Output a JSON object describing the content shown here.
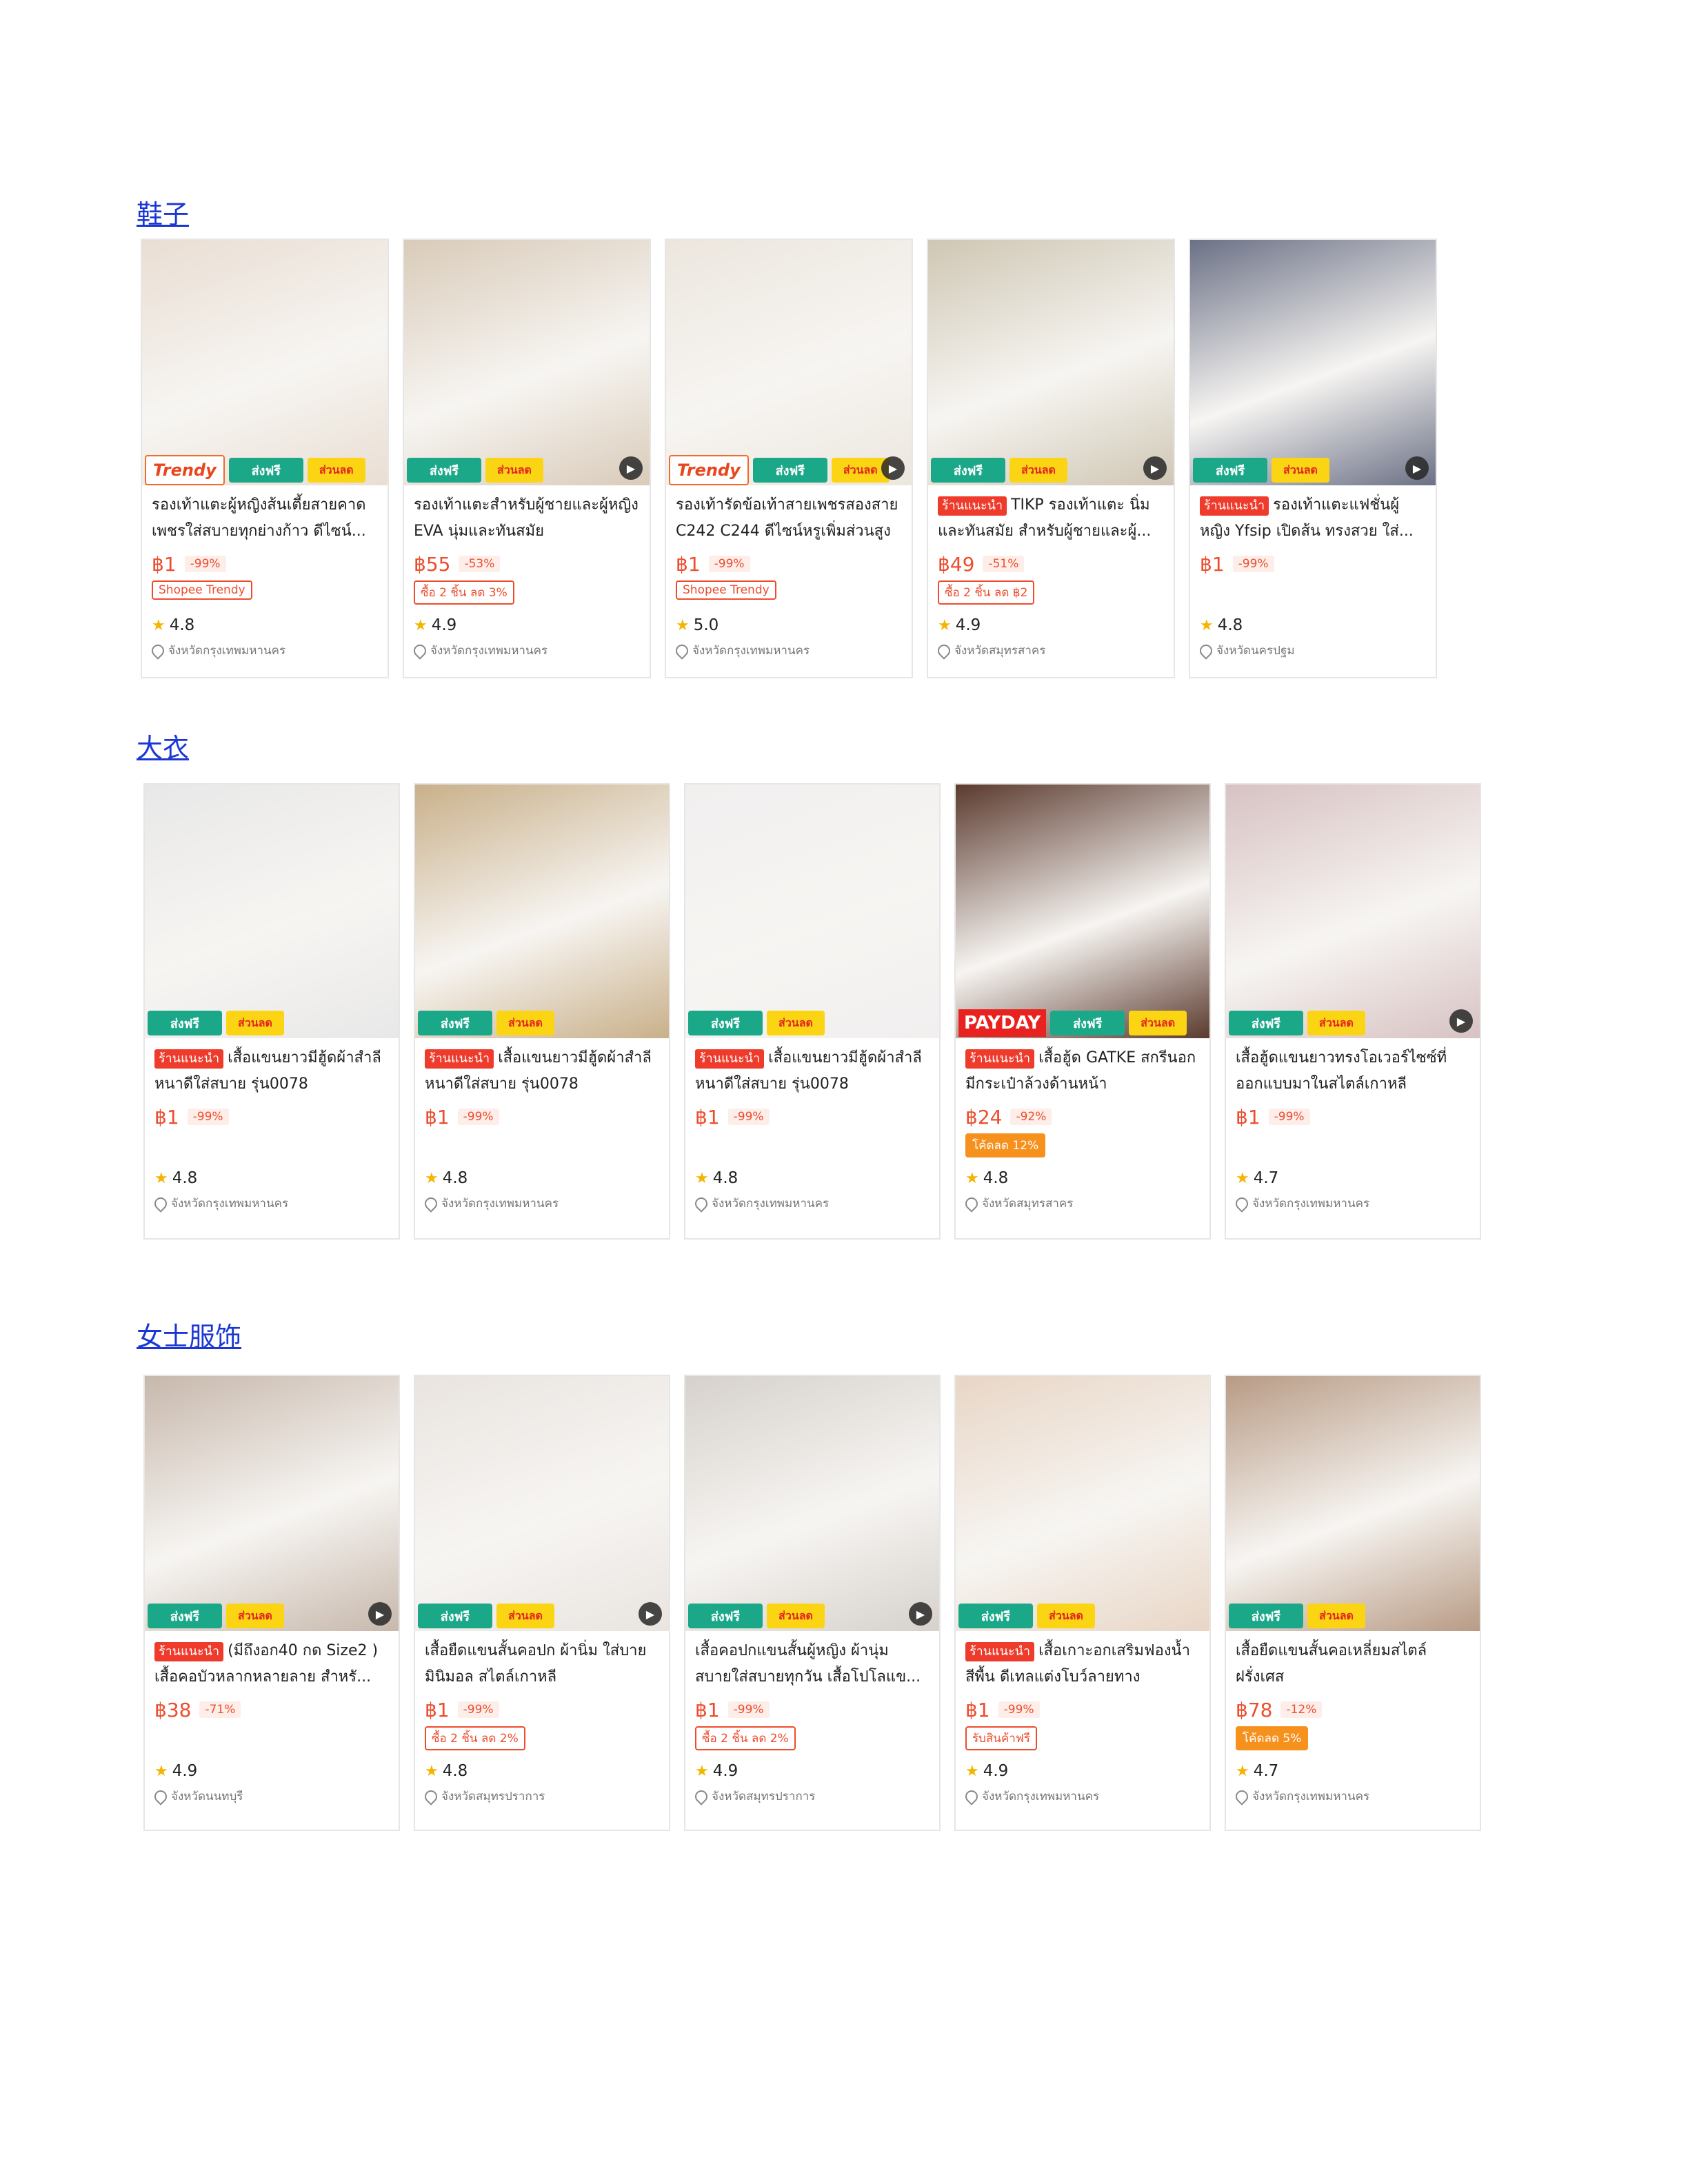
{
  "sections": [
    {
      "title": "鞋子",
      "items": [
        {
          "badges": [
            "Trendy",
            "free",
            "discount"
          ],
          "rec": false,
          "name": "รองเท้าแตะผู้หญิงส้นเตี้ยสายคาด เพชรใส่สบายทุกย่างก้าว ดีไซน์...",
          "price": "฿1",
          "disc": "-99%",
          "promo": "Shopee Trendy",
          "promo_fill": false,
          "rating": "4.8",
          "loc": "จังหวัดกรุงเทพมหานคร",
          "play": false
        },
        {
          "badges": [
            "free",
            "discount"
          ],
          "rec": false,
          "name": "รองเท้าแตะสำหรับผู้ชายและผู้หญิง EVA นุ่มและทันสมัย",
          "price": "฿55",
          "disc": "-53%",
          "promo": "ซื้อ 2 ชิ้น ลด 3%",
          "promo_fill": false,
          "rating": "4.9",
          "loc": "จังหวัดกรุงเทพมหานคร",
          "play": true
        },
        {
          "badges": [
            "Trendy",
            "free",
            "discount"
          ],
          "rec": false,
          "name": "รองเท้ารัดข้อเท้าสายเพชรสองสาย C242 C244 ดีไซน์หรูเพิ่มส่วนสูง",
          "price": "฿1",
          "disc": "-99%",
          "promo": "Shopee Trendy",
          "promo_fill": false,
          "rating": "5.0",
          "loc": "จังหวัดกรุงเทพมหานคร",
          "play": true
        },
        {
          "badges": [
            "free",
            "discount"
          ],
          "rec": true,
          "name": "TIKP รองเท้าแตะ นิ่มและทันสมัย สำหรับผู้ชายและผู้...",
          "price": "฿49",
          "disc": "-51%",
          "promo": "ซื้อ 2 ชิ้น ลด ฿2",
          "promo_fill": false,
          "rating": "4.9",
          "loc": "จังหวัดสมุทรสาคร",
          "play": true
        },
        {
          "badges": [
            "free",
            "discount"
          ],
          "rec": true,
          "name": "รองเท้าแตะแฟชั่นผู้หญิง Yfsip เปิดส้น ทรงสวย ใส่...",
          "price": "฿1",
          "disc": "-99%",
          "promo": "",
          "promo_fill": false,
          "rating": "4.8",
          "loc": "จังหวัดนครปฐม",
          "play": true
        }
      ]
    },
    {
      "title": "大衣",
      "items": [
        {
          "badges": [
            "free",
            "discount"
          ],
          "rec": true,
          "name": "เสื้อแขนยาวมีฮู้ดผ้าสำลี หนาดีใส่สบาย รุ่น0078",
          "price": "฿1",
          "disc": "-99%",
          "promo": "",
          "promo_fill": false,
          "rating": "4.8",
          "loc": "จังหวัดกรุงเทพมหานคร",
          "play": false
        },
        {
          "badges": [
            "free",
            "discount"
          ],
          "rec": true,
          "name": "เสื้อแขนยาวมีฮู้ดผ้าสำลี หนาดีใส่สบาย รุ่น0078",
          "price": "฿1",
          "disc": "-99%",
          "promo": "",
          "promo_fill": false,
          "rating": "4.8",
          "loc": "จังหวัดกรุงเทพมหานคร",
          "play": false
        },
        {
          "badges": [
            "free",
            "discount"
          ],
          "rec": true,
          "name": "เสื้อแขนยาวมีฮู้ดผ้าสำลี หนาดีใส่สบาย รุ่น0078",
          "price": "฿1",
          "disc": "-99%",
          "promo": "",
          "promo_fill": false,
          "rating": "4.8",
          "loc": "จังหวัดกรุงเทพมหานคร",
          "play": false
        },
        {
          "badges": [
            "PAYDAY",
            "free",
            "discount"
          ],
          "rec": true,
          "name": "เสื้อฮู้ด GATKE สกรีนอก มีกระเป๋าล้วงด้านหน้า",
          "price": "฿24",
          "disc": "-92%",
          "promo": "โค้ดลด 12%",
          "promo_fill": true,
          "rating": "4.8",
          "loc": "จังหวัดสมุทรสาคร",
          "play": false
        },
        {
          "badges": [
            "free",
            "discount"
          ],
          "rec": false,
          "name": "เสื้อฮู้ดแขนยาวทรงโอเวอร์ไซซ์ที่ออกแบบมาในสไตล์เกาหลี",
          "price": "฿1",
          "disc": "-99%",
          "promo": "",
          "promo_fill": false,
          "rating": "4.7",
          "loc": "จังหวัดกรุงเทพมหานคร",
          "play": true
        }
      ]
    },
    {
      "title": "女士服饰",
      "items": [
        {
          "badges": [
            "free",
            "discount"
          ],
          "rec": true,
          "name": "(มีถึงอก40 กด Size2 ) เสื้อคอบัวหลากหลายลาย สำหรั...",
          "price": "฿38",
          "disc": "-71%",
          "promo": "",
          "promo_fill": false,
          "rating": "4.9",
          "loc": "จังหวัดนนทบุรี",
          "play": true
        },
        {
          "badges": [
            "free",
            "discount"
          ],
          "rec": false,
          "name": "เสื้อยืดแขนสั้นคอปก ผ้านิ่ม ใส่บาย มินิมอล สไตล์เกาหลี",
          "price": "฿1",
          "disc": "-99%",
          "promo": "ซื้อ 2 ชิ้น ลด 2%",
          "promo_fill": false,
          "rating": "4.8",
          "loc": "จังหวัดสมุทรปราการ",
          "play": true
        },
        {
          "badges": [
            "free",
            "discount"
          ],
          "rec": false,
          "name": "เสื้อคอปกแขนสั้นผู้หญิง ผ้านุ่ม สบายใส่สบายทุกวัน เสื้อโปโลแข...",
          "price": "฿1",
          "disc": "-99%",
          "promo": "ซื้อ 2 ชิ้น ลด 2%",
          "promo_fill": false,
          "rating": "4.9",
          "loc": "จังหวัดสมุทรปราการ",
          "play": true
        },
        {
          "badges": [
            "free",
            "discount"
          ],
          "rec": true,
          "name": "เสื้อเกาะอกเสริมฟองน้ำ สีพื้น ดีเทลแต่งโบว์ลายทาง",
          "price": "฿1",
          "disc": "-99%",
          "promo": "รับสินค้าฟรี",
          "promo_fill": false,
          "rating": "4.9",
          "loc": "จังหวัดกรุงเทพมหานคร",
          "play": false
        },
        {
          "badges": [
            "free",
            "discount"
          ],
          "rec": false,
          "name": "เสื้อยืดแขนสั้นคอเหลี่ยมสไตล์ฝรั่งเศส",
          "price": "฿78",
          "disc": "-12%",
          "promo": "โค้ดลด 5%",
          "promo_fill": true,
          "rating": "4.7",
          "loc": "จังหวัดกรุงเทพมหานคร",
          "play": false
        }
      ]
    }
  ],
  "labels": {
    "rec": "ร้านแนะนำ",
    "free": "ส่งฟรี",
    "discount": "ส่วนลด",
    "trendy": "Trendy",
    "payday": "PAYDAY",
    "play": "▶",
    "star": "★"
  },
  "colors": {
    "link": "#1a37d6",
    "price": "#ee4d2d",
    "free_badge": "#1aa889",
    "discount_badge": "#fbd514"
  }
}
